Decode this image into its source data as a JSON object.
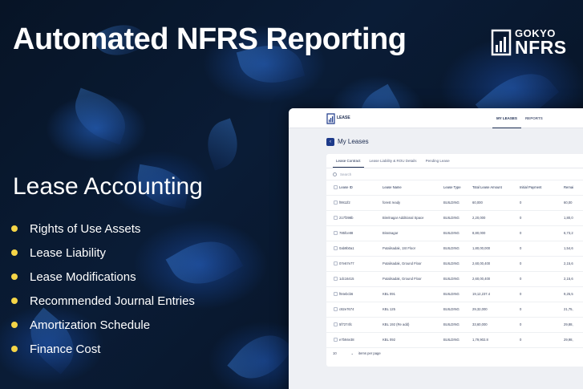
{
  "banner": {
    "headline": "Automated NFRS Reporting",
    "logo_top": "GOKYO",
    "logo_bottom": "NFRS",
    "subhead": "Lease Accounting",
    "features": [
      "Rights of Use Assets",
      "Lease Liability",
      "Lease Modifications",
      "Recommended Journal Entries",
      "Amortization Schedule",
      "Finance Cost"
    ],
    "bullet_color": "#f5d547"
  },
  "app": {
    "title": "LEASE",
    "nav": [
      "MY LEASES",
      "REPORTS"
    ],
    "page_title": "My Leases",
    "back_icon": "chevron-left-icon",
    "tabs": [
      "Lease Contract",
      "Lease Liability & ROU Details",
      "Pending Lease"
    ],
    "search_placeholder": "Search",
    "columns": [
      "Lease ID",
      "Lease Name",
      "Lease Type",
      "Total Lease Amount",
      "Initial Payment",
      "Remai"
    ],
    "rows": [
      [
        "f9911f2",
        "forest ready",
        "BUILDING",
        "60,000",
        "0",
        "60,00"
      ],
      [
        "217f398b",
        "Birelnagar Additional Space",
        "BUILDING",
        "2,20,000",
        "0",
        "1,80,0"
      ],
      [
        "785fce88",
        "Biratnagar",
        "BUILDING",
        "8,80,000",
        "0",
        "6,73,2"
      ],
      [
        "0ab9b0a1",
        "Putalisadak, 1St Floor",
        "BUILDING",
        "1,80,00,000",
        "0",
        "1,54,6"
      ],
      [
        "07e67e77",
        "Putalisadak, Ground Floor",
        "BUILDING",
        "2,60,00,400",
        "0",
        "2,15,6"
      ],
      [
        "1dc16415",
        "Putalisadak, Ground Floor",
        "BUILDING",
        "2,60,00,400",
        "0",
        "2,15,6"
      ],
      [
        "f94ebcb6",
        "KBL 091",
        "BUILDING",
        "19,12,237.4",
        "0",
        "9,25,5"
      ],
      [
        "c82e7674",
        "KBL 125",
        "BUILDING",
        "29,32,000",
        "0",
        "21,75,"
      ],
      [
        "5f7274fc",
        "KBL 192 (Re add)",
        "BUILDING",
        "33,60,000",
        "0",
        "29,88,"
      ],
      [
        "e7b94e38",
        "KBL 092",
        "BUILDING",
        "1,79,902.8",
        "0",
        "29,98,"
      ]
    ],
    "page_size": "10",
    "per_page_label": "items per page",
    "accent": "#1d3a8a"
  }
}
